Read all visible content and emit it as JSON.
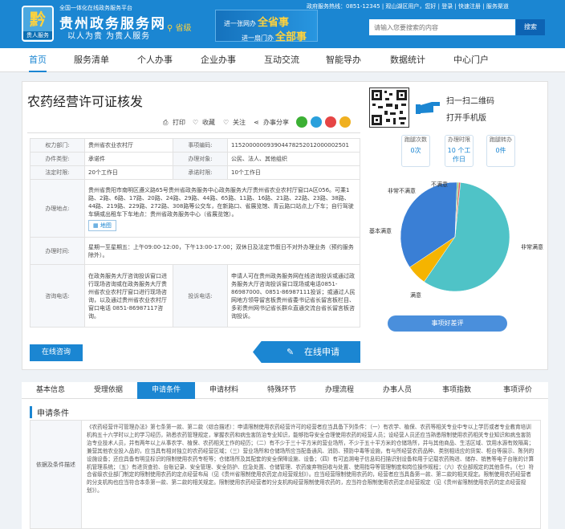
{
  "header": {
    "logo_glyph": "黔",
    "logo_caption": "贵人服务",
    "site_subtitle": "全国一体化在线政务服务平台",
    "site_title": "贵州政务服务网",
    "slogan": "以人为贵 为贵人服务",
    "region": "省级",
    "banner_line1_prefix": "进一张网办",
    "banner_line1_emph": "全省事",
    "banner_line2_prefix": "进一扇门办",
    "banner_line2_emph": "全部事",
    "top_links": "政府服务热线：0851-12345 | 观山湖区用户，您好 | 登录 | 快速注册 | 服务渠道",
    "search_placeholder": "请输入您要搜索的内容",
    "search_button": "搜索"
  },
  "nav": {
    "items": [
      "首页",
      "服务清单",
      "个人办事",
      "企业办事",
      "互动交流",
      "智能导办",
      "数据统计",
      "中心门户"
    ]
  },
  "page": {
    "title": "农药经营许可证核发",
    "actions": {
      "print": "打印",
      "favorite": "收藏",
      "follow": "关注",
      "share": "办事分享"
    }
  },
  "info": {
    "rows": [
      {
        "k1": "权力部门:",
        "v1": "贵州省农业农村厅",
        "k2": "事项编码:",
        "v2": "115200000093904478252012000002501"
      },
      {
        "k1": "办件类型:",
        "v1": "承诺件",
        "k2": "办理对象:",
        "v2": "公民、法人、其他组织"
      },
      {
        "k1": "法定时限:",
        "v1": "20个工作日",
        "k2": "承诺时限:",
        "v2": "10个工作日"
      }
    ],
    "address_label": "办理地点:",
    "address": "贵州省贵阳市南明区遵义路65号贵州省政务服务中心政务服务大厅贵州省农业农村厅窗口A区056。可乘1路、2路、6路、17路、20路、24路、29路、44路、65路、11路、16路、21路、22路、23路、38路、44路、219路、229路、272路、308路等公交车，在新路口、省展览馆、青云路口站点上/下车；自行驾驶车辆或出租车下车地点：贵州省政务服务中心（省展览馆）。",
    "map_label": "地图",
    "hours_label": "办理时间:",
    "hours": "星期一至星期五：上午09:00-12:00，下午13:00-17:00；双休日及法定节假日不对外办理业务（预约服务除外）。",
    "consult_label": "咨询电话:",
    "consult": "在政务服务大厅咨询投诉窗口进行现场咨询或在政务服务大厅贵州省农业农村厅窗口进行现场咨询，以及通过贵州省农业农村厅窗口电话 0851-86987117咨询。",
    "complaint_label": "投诉电话:",
    "complaint": "申请人可在贵州政务服务网在线咨询投诉或通过政务服务大厅咨询投诉窗口现场或电话0851-86987000、0851-86987111投诉；或通过人民网地方领导留言板贵州省委书记省长留言板栏目、多彩贵州网书记省长群众直通交流台省长留言板咨询投诉。",
    "consult_button": "在线咨询",
    "apply_button": "在线申请"
  },
  "side": {
    "scan_text": "扫一扫二维码",
    "mobile_text": "打开手机版",
    "stats": [
      {
        "label": "跑腿次数",
        "value": "0次"
      },
      {
        "label": "办理时限",
        "value": "10 个工作日"
      },
      {
        "label": "跑腿转办",
        "value": "0件"
      }
    ],
    "eval_button": "事项好差评"
  },
  "chart_data": {
    "type": "pie",
    "categories": [
      "非常满意",
      "满意",
      "基本满意",
      "不满意",
      "非常不满意"
    ],
    "values": [
      58,
      6,
      35,
      0.5,
      0.5
    ],
    "colors": [
      "#4fc3c7",
      "#f5b400",
      "#3a7fd5",
      "#8dc26f",
      "#e05b5b"
    ]
  },
  "tabs": {
    "items": [
      "基本信息",
      "受理依据",
      "申请条件",
      "申请材料",
      "特殊环节",
      "办理流程",
      "办事人员",
      "事项指数",
      "事项评价"
    ],
    "active": 2
  },
  "conditions": {
    "heading": "申请条件",
    "key": "依据及条件描述",
    "text": "《农药经营许可管理办法》第七条第一款、第二款（综合描述）：申请限制使用农药经营许可的经营者应当具备下列条件：（一）有农学、植保、农药等相关专业中专以上学历或者专业教育培训机构五十六学时以上的学习经历，熟悉农药管理规定，掌握农药和病虫害防治专业知识，能够指导安全合理使用农药的经营人员；设经营人员还应当熟悉限制使用农药相关专业知识和病虫害防治专业技术人员，并有两年以上从事农学、植保、农药相关工作的经历；（二）有不少于三十平方米的营业场所，不少于五十平方米的仓储场所，并与其他商品、生活区域、饮用水源有效隔离；兼营其他农业投入品的，应当具有相对独立的农药经营区域；（三）营业场所和仓储场所应当配备通风、消防、预防中毒等设施，有与所经营农药品种、类别相适应的货架、柜台等展示、陈列的设施设备；还应具备有明显标识的限制使用农药专柜等；仓储场所及其配套的安全保障设施、设备；（四）有可追溯电子信息码扫描识别设备和用于记载农药购进、储存、销售等电子台账的计算机管理系统；（五）有进货查验、台账记录、安全管理、安全防护、应急处置、仓储管理、农药废弃物回收与处置、使用指导等管理制度和岗位操作规程；（六）农业部规定的其他条件。（七）符合省级农业部门制定的限制使用农药的定点经营布局（见《贵州省限制使用农药定点经营规划》）。应当经营限制使用农药的，经营者应当具备第一款、第二款的相关规定。限制使用农药经营者的分支机构也应当符合本条第一款、第二款的相关规定。限制使用农药经营者的分支机构经营限制使用农药的，应当符合限制使用农药定点经营规定（见《贵州省限制使用农药的定点经营规划》）。"
  }
}
